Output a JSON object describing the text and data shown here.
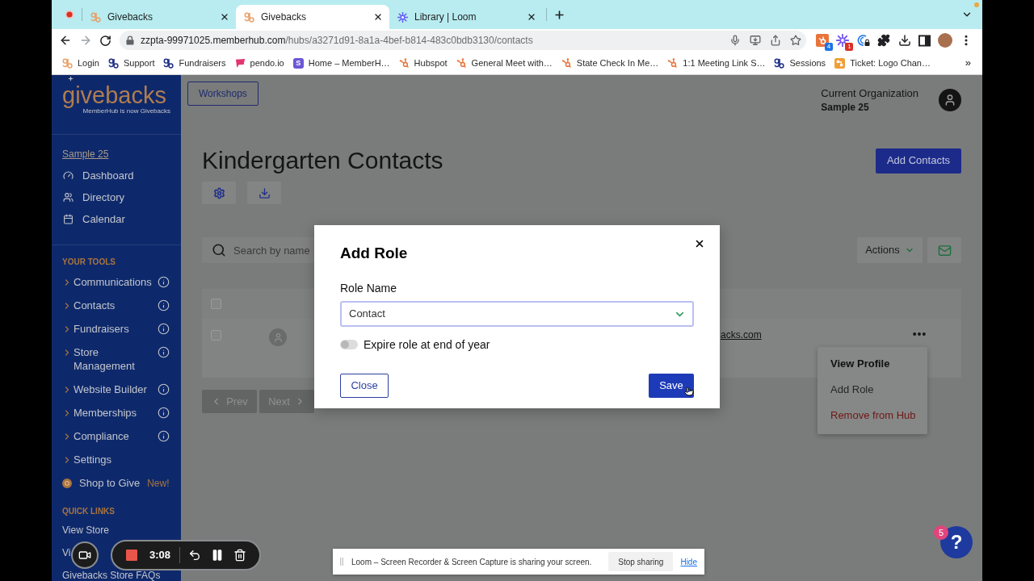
{
  "browser": {
    "tabs": [
      {
        "title": "Givebacks",
        "kind": "gb",
        "selected": false
      },
      {
        "title": "Givebacks",
        "kind": "gb",
        "selected": true
      },
      {
        "title": "Library | Loom",
        "kind": "loom",
        "selected": false
      }
    ],
    "address": {
      "host": "zzpta-99971025.memberhub.com",
      "path": "/hubs/a3271d91-8a1a-4bef-b814-483c0bdb3130/contacts"
    },
    "extensions": [
      {
        "kind": "sprocket",
        "badge": "4",
        "color": "#1a73e8"
      },
      {
        "kind": "sparkle",
        "badge": "1",
        "color": "#d93025"
      },
      {
        "kind": "ringlock"
      },
      {
        "kind": "puzzle"
      },
      {
        "kind": "download"
      },
      {
        "kind": "panel"
      },
      {
        "kind": "avatar"
      },
      {
        "kind": "menu"
      }
    ],
    "bookmarks": [
      {
        "label": "Login",
        "kind": "gb",
        "color": "#e8a06a"
      },
      {
        "label": "Support",
        "kind": "gb",
        "color": "#1e2f86"
      },
      {
        "label": "Fundraisers",
        "kind": "gb",
        "color": "#1e2f86"
      },
      {
        "label": "pendo.io",
        "kind": "pendo"
      },
      {
        "label": "Home – MemberH…",
        "kind": "letter",
        "letter": "S"
      },
      {
        "label": "Hubspot",
        "kind": "hubspot"
      },
      {
        "label": "General Meet with…",
        "kind": "hubspot"
      },
      {
        "label": "State Check In Me…",
        "kind": "hubspot"
      },
      {
        "label": "1:1 Meeting Link S…",
        "kind": "hubspot"
      },
      {
        "label": "Sessions",
        "kind": "gb",
        "color": "#1e2f86"
      },
      {
        "label": "Ticket: Logo Chan…",
        "kind": "ticket"
      }
    ],
    "bookmarks_overflow": "»"
  },
  "sidebar": {
    "logo": "givebacks",
    "tagline": "MemberHub is now Givebacks",
    "org_link": "Sample 25",
    "nav": [
      "Dashboard",
      "Directory",
      "Calendar"
    ],
    "tools_heading": "YOUR TOOLS",
    "tools": [
      {
        "label": "Communications",
        "info": true
      },
      {
        "label": "Contacts",
        "info": true
      },
      {
        "label": "Fundraisers",
        "info": true
      },
      {
        "label": "Store Management",
        "info": true
      },
      {
        "label": "Website Builder",
        "info": true
      },
      {
        "label": "Memberships",
        "info": true
      },
      {
        "label": "Compliance",
        "info": true
      },
      {
        "label": "Settings",
        "info": false
      }
    ],
    "promo": {
      "label": "Shop to Give",
      "tag": "New!"
    },
    "quick_heading": "QUICK LINKS",
    "quick_links": [
      "View Store",
      "Vi",
      "Givebacks Store FAQs"
    ]
  },
  "header": {
    "workshops": "Workshops",
    "org_caption": "Current Organization",
    "org_name": "Sample 25"
  },
  "page": {
    "title": "Kindergarten Contacts",
    "add_contacts": "Add Contacts",
    "search": {
      "placeholder": "Search by name"
    },
    "actions": "Actions",
    "table": {
      "select_all": {
        "checked": false
      },
      "rows": [
        {
          "checked": false,
          "email": "acks.com"
        }
      ]
    },
    "pagination": {
      "prev": "Prev",
      "next": "Next"
    },
    "row_menu": [
      {
        "label": "View Profile",
        "kind": "default",
        "selected": true
      },
      {
        "label": "Add Role",
        "kind": "default",
        "selected": false
      },
      {
        "label": "Remove from Hub",
        "kind": "danger",
        "selected": false
      }
    ]
  },
  "modal": {
    "title": "Add Role",
    "field_label": "Role Name",
    "role": "Contact",
    "expire": {
      "label": "Expire role at end of year",
      "on": false
    },
    "close": "Close",
    "save": "Save"
  },
  "recorder": {
    "time": "3:08"
  },
  "share_bar": {
    "message": "Loom – Screen Recorder & Screen Capture is sharing your screen.",
    "stop": "Stop sharing",
    "hide": "Hide"
  },
  "help": {
    "label": "?",
    "badge": "5"
  }
}
